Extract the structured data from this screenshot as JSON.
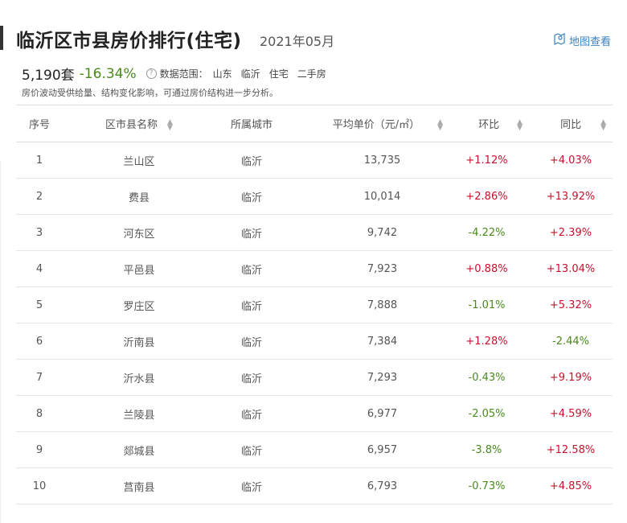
{
  "header": {
    "title": "临沂区市县房价排行(住宅)",
    "date": "2021年05月",
    "map_link": "地图查看"
  },
  "stats": {
    "count": "5,190套",
    "change": "-16.34%",
    "scope_label": "数据范围：",
    "scope": [
      "山东",
      "临沂",
      "住宅",
      "二手房"
    ]
  },
  "note": "房价波动受供给量、结构变化影响，可通过房价结构进一步分析。",
  "table": {
    "headers": [
      "序号",
      "区市县名称",
      "所属城市",
      "平均单价（元/㎡）",
      "环比",
      "同比"
    ],
    "rows": [
      {
        "rank": "1",
        "name": "兰山区",
        "city": "临沂",
        "price": "13,735",
        "mom": "+1.12%",
        "yoy": "+4.03%"
      },
      {
        "rank": "2",
        "name": "费县",
        "city": "临沂",
        "price": "10,014",
        "mom": "+2.86%",
        "yoy": "+13.92%"
      },
      {
        "rank": "3",
        "name": "河东区",
        "city": "临沂",
        "price": "9,742",
        "mom": "-4.22%",
        "yoy": "+2.39%"
      },
      {
        "rank": "4",
        "name": "平邑县",
        "city": "临沂",
        "price": "7,923",
        "mom": "+0.88%",
        "yoy": "+13.04%"
      },
      {
        "rank": "5",
        "name": "罗庄区",
        "city": "临沂",
        "price": "7,888",
        "mom": "-1.01%",
        "yoy": "+5.32%"
      },
      {
        "rank": "6",
        "name": "沂南县",
        "city": "临沂",
        "price": "7,384",
        "mom": "+1.28%",
        "yoy": "-2.44%"
      },
      {
        "rank": "7",
        "name": "沂水县",
        "city": "临沂",
        "price": "7,293",
        "mom": "-0.43%",
        "yoy": "+9.19%"
      },
      {
        "rank": "8",
        "name": "兰陵县",
        "city": "临沂",
        "price": "6,977",
        "mom": "-2.05%",
        "yoy": "+4.59%"
      },
      {
        "rank": "9",
        "name": "郯城县",
        "city": "临沂",
        "price": "6,957",
        "mom": "-3.8%",
        "yoy": "+12.58%"
      },
      {
        "rank": "10",
        "name": "莒南县",
        "city": "临沂",
        "price": "6,793",
        "mom": "-0.73%",
        "yoy": "+4.85%"
      }
    ]
  },
  "colors": {
    "rise": "#c8102e",
    "fall": "#4a8a1c",
    "link": "#3b82c4"
  },
  "icons": {
    "map": "map-pin-icon",
    "help": "question-circle-icon",
    "sort": "sort-arrows-icon"
  }
}
